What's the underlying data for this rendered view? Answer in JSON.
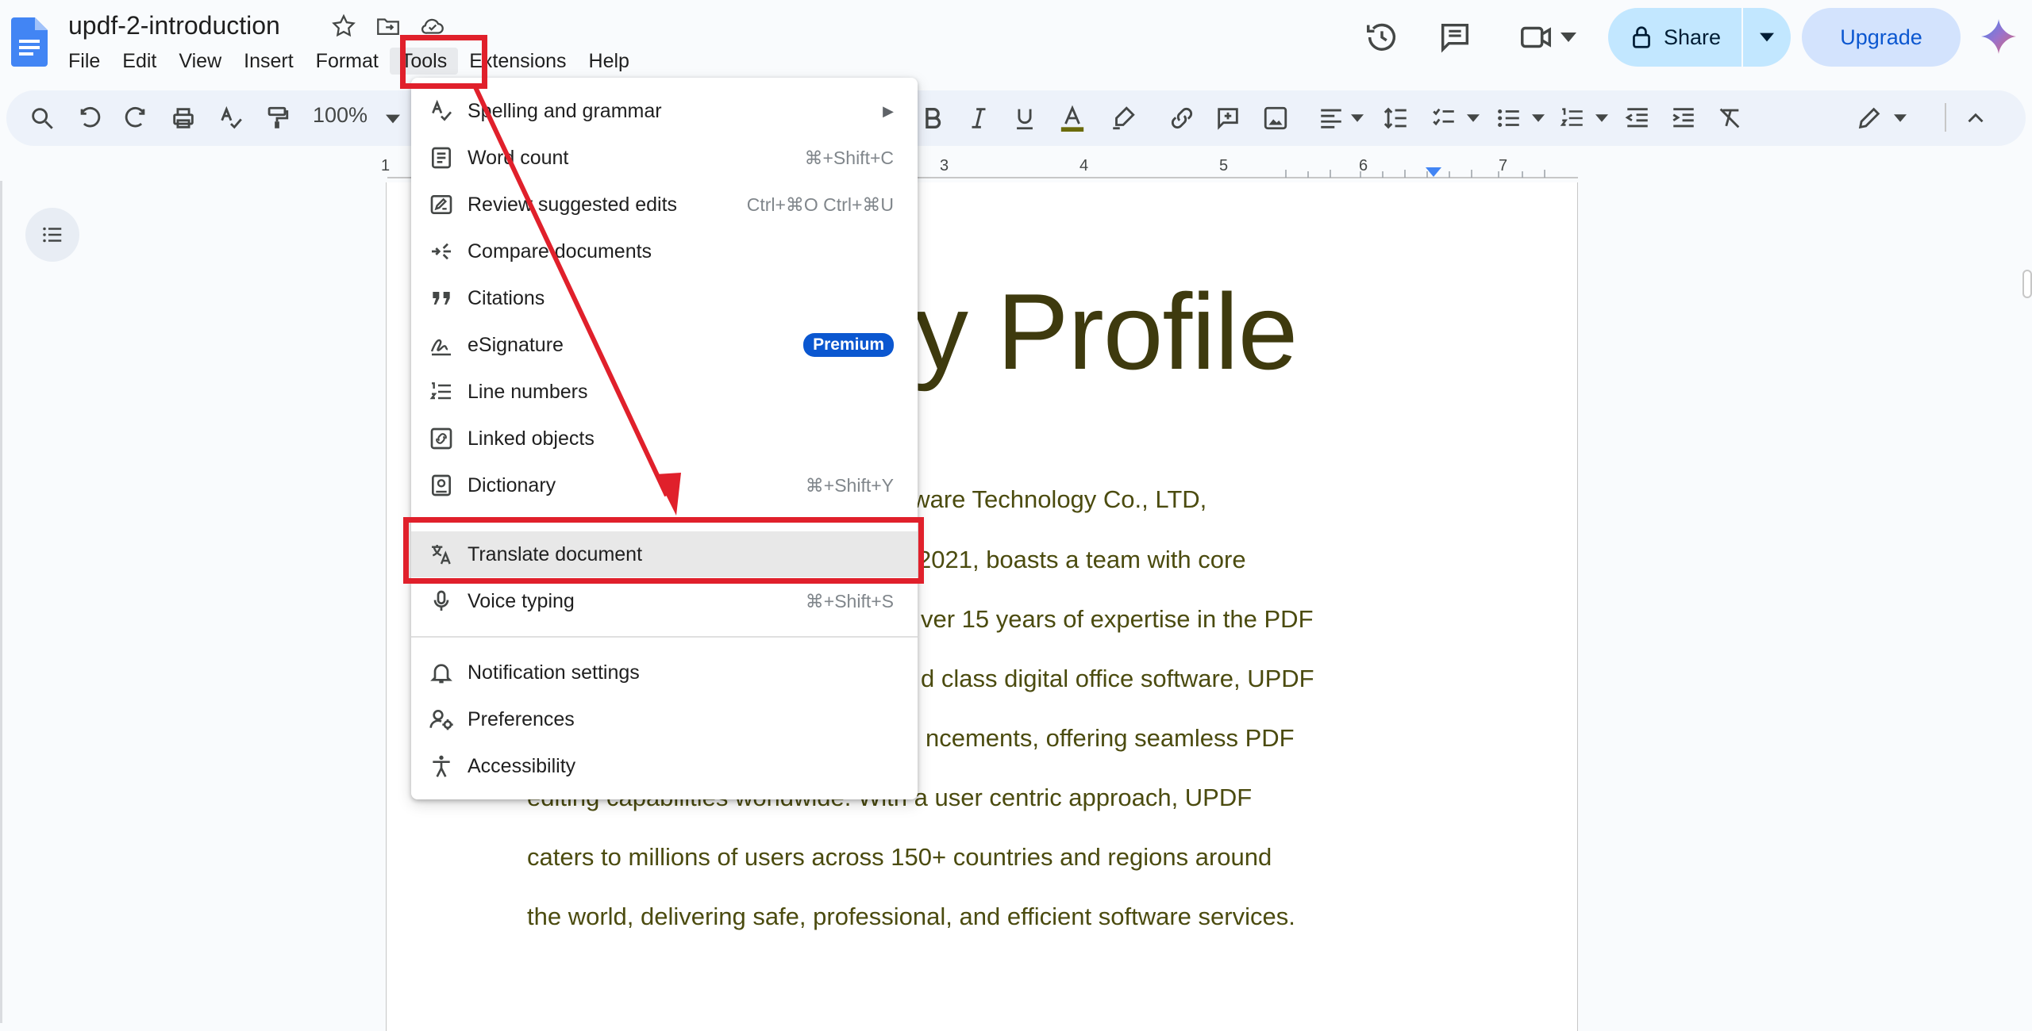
{
  "document": {
    "title": "updf-2-introduction",
    "heading": "y Profile",
    "body_lines": [
      "ftware Technology Co., LTD,",
      "2021, boasts a team with core",
      "ver 15 years of expertise in the PDF",
      "d class digital office software, UPDF",
      "ncements, offering seamless PDF",
      "editing capabilities worldwide. With a user centric approach, UPDF",
      "caters to millions of users across 150+ countries and regions around",
      "the world, delivering safe, professional, and efficient software services."
    ]
  },
  "menubar": [
    "File",
    "Edit",
    "View",
    "Insert",
    "Format",
    "Tools",
    "Extensions",
    "Help"
  ],
  "header": {
    "share_label": "Share",
    "upgrade_label": "Upgrade"
  },
  "toolbar": {
    "zoom": "100%"
  },
  "ruler": [
    "1",
    "3",
    "4",
    "5",
    "6",
    "7"
  ],
  "tools_menu": {
    "items": [
      {
        "label": "Spelling and grammar",
        "shortcut": "",
        "icon": "spellcheck-icon",
        "submenu": true
      },
      {
        "label": "Word count",
        "shortcut": "⌘+Shift+C",
        "icon": "word-count-icon"
      },
      {
        "label": "Review suggested edits",
        "shortcut": "Ctrl+⌘O Ctrl+⌘U",
        "icon": "review-edits-icon"
      },
      {
        "label": "Compare documents",
        "shortcut": "",
        "icon": "compare-icon"
      },
      {
        "label": "Citations",
        "shortcut": "",
        "icon": "quote-icon"
      },
      {
        "label": "eSignature",
        "shortcut": "",
        "icon": "signature-icon",
        "badge": "Premium"
      },
      {
        "label": "Line numbers",
        "shortcut": "",
        "icon": "line-numbers-icon"
      },
      {
        "label": "Linked objects",
        "shortcut": "",
        "icon": "link-box-icon"
      },
      {
        "label": "Dictionary",
        "shortcut": "⌘+Shift+Y",
        "icon": "dictionary-icon"
      },
      {
        "label": "Translate document",
        "shortcut": "",
        "icon": "translate-icon",
        "highlighted": true
      },
      {
        "label": "Voice typing",
        "shortcut": "⌘+Shift+S",
        "icon": "microphone-icon"
      },
      {
        "label": "Notification settings",
        "shortcut": "",
        "icon": "bell-icon"
      },
      {
        "label": "Preferences",
        "shortcut": "",
        "icon": "preferences-icon"
      },
      {
        "label": "Accessibility",
        "shortcut": "",
        "icon": "accessibility-icon"
      }
    ]
  },
  "annotations": {
    "color": "#e0202b"
  }
}
